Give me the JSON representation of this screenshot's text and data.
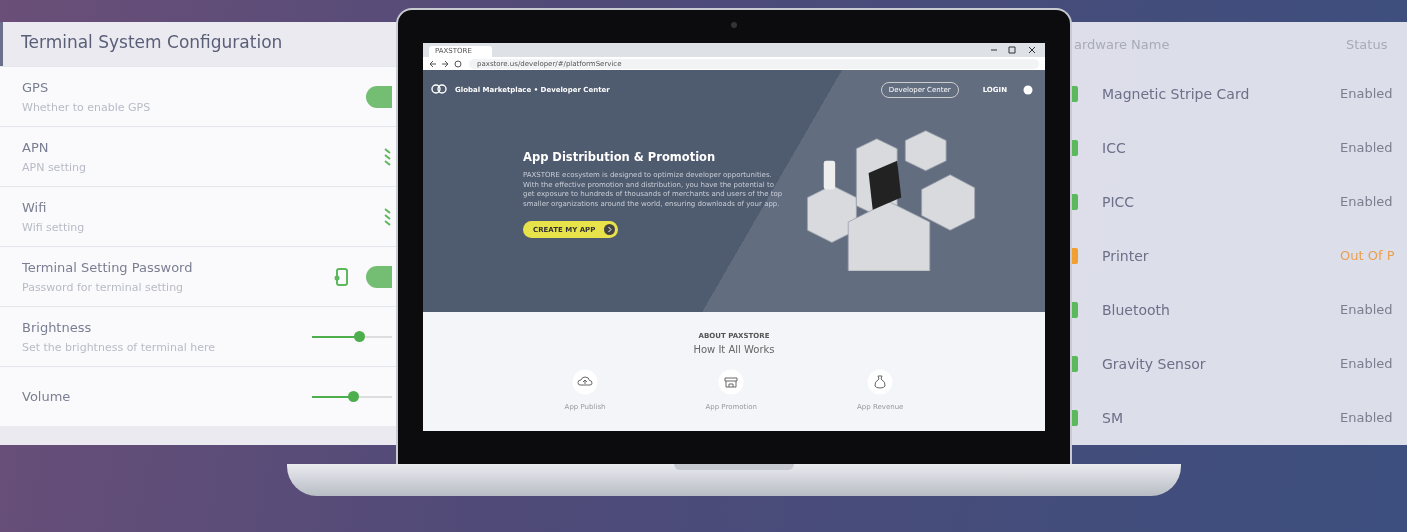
{
  "config_panel": {
    "title": "Terminal System Configuration",
    "settings": [
      {
        "kind": "toggle",
        "name": "GPS",
        "description": "Whether to enable GPS",
        "on": true
      },
      {
        "kind": "icon",
        "name": "APN",
        "description": "APN setting"
      },
      {
        "kind": "icon",
        "name": "Wifi",
        "description": "Wifi setting"
      },
      {
        "kind": "toggle",
        "name": "Terminal Setting Password",
        "description": "Password for terminal setting",
        "on": true
      },
      {
        "kind": "slider",
        "name": "Brightness",
        "description": "Set the brightness of terminal here",
        "level": 0.6
      },
      {
        "kind": "slider",
        "name": "Volume",
        "level": 0.52
      }
    ]
  },
  "browser": {
    "tab_title": "PAXSTORE",
    "url": "paxstore.us/developer/#/platformService",
    "nav": {
      "brand": "Global Marketplace • Developer Center",
      "button": "Developer Center",
      "login": "LOGIN"
    },
    "hero": {
      "title": "App Distribution & Promotion",
      "text": "PAXSTORE ecosystem is designed to optimize developer opportunities. With the effective promotion and distribution, you have the potential to get exposure to hundreds of thousands of merchants and users of the top smaller organizations around the world, ensuring downloads of your app.",
      "button": "CREATE MY APP"
    },
    "section": {
      "eyebrow": "ABOUT PAXSTORE",
      "title": "How It All Works",
      "features": [
        {
          "kind": "publish",
          "label": "App Publish"
        },
        {
          "kind": "promotion",
          "label": "App Promotion"
        },
        {
          "kind": "revenue",
          "label": "App Revenue"
        }
      ]
    }
  },
  "hardware_table": {
    "columns": [
      "ardware Name",
      "Status"
    ],
    "rows": [
      {
        "name": "Magnetic Stripe Card",
        "status": "Enabled",
        "color": "#5cb85c",
        "warning": false
      },
      {
        "name": "ICC",
        "status": "Enabled",
        "color": "#5cb85c",
        "warning": false
      },
      {
        "name": "PICC",
        "status": "Enabled",
        "color": "#5cb85c",
        "warning": false
      },
      {
        "name": "Printer",
        "status": "Out Of P",
        "color": "#f0a030",
        "warning": true
      },
      {
        "name": "Bluetooth",
        "status": "Enabled",
        "color": "#5cb85c",
        "warning": false
      },
      {
        "name": "Gravity Sensor",
        "status": "Enabled",
        "color": "#5cb85c",
        "warning": false
      },
      {
        "name": "SM",
        "status": "Enabled",
        "color": "#5cb85c",
        "warning": false
      }
    ]
  }
}
